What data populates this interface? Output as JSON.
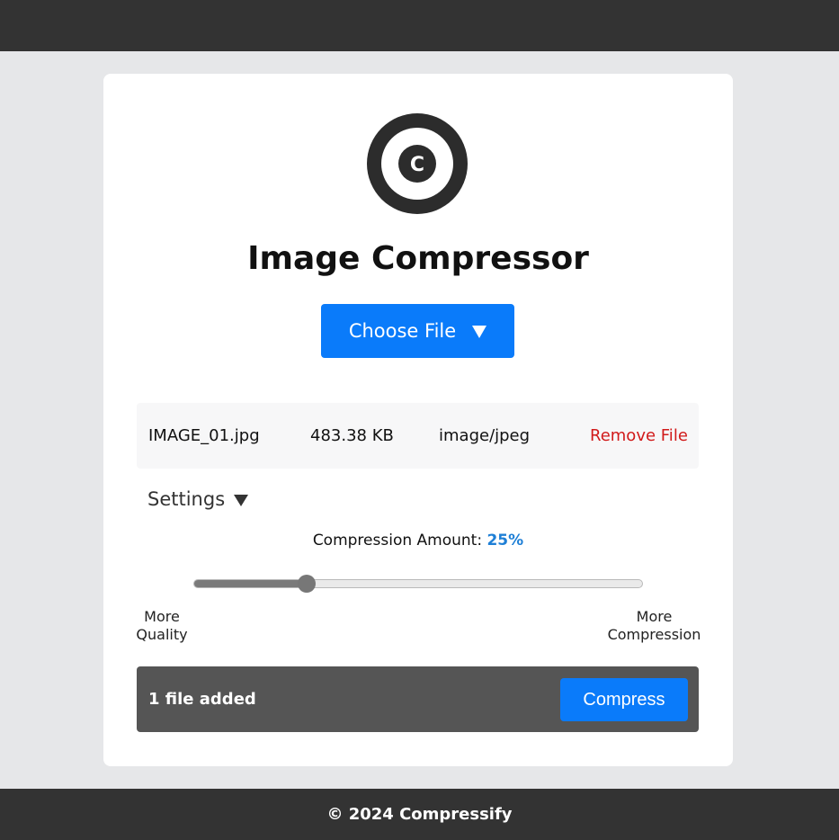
{
  "header": {},
  "app": {
    "logo_letter": "C",
    "title": "Image Compressor",
    "choose_file_label": "Choose File"
  },
  "file": {
    "name": "IMAGE_01.jpg",
    "size": "483.38 KB",
    "type": "image/jpeg",
    "remove_label": "Remove File"
  },
  "settings": {
    "label": "Settings",
    "compression_label": "Compression Amount:",
    "compression_value": "25%",
    "slider_fraction": 0.25,
    "left_label_line1": "More",
    "left_label_line2": "Quality",
    "right_label_line1": "More",
    "right_label_line2": "Compression"
  },
  "actions": {
    "files_added": "1 file added",
    "compress_label": "Compress"
  },
  "footer": {
    "text": "© 2024 Compressify"
  },
  "colors": {
    "accent": "#0a7bfa",
    "danger": "#d11a1a",
    "bar": "#333333",
    "percent": "#1e7fd6"
  },
  "icons": {
    "logo": "compress-logo-icon",
    "choose_chevron": "chevron-down-icon",
    "settings_chevron": "triangle-down-icon"
  }
}
